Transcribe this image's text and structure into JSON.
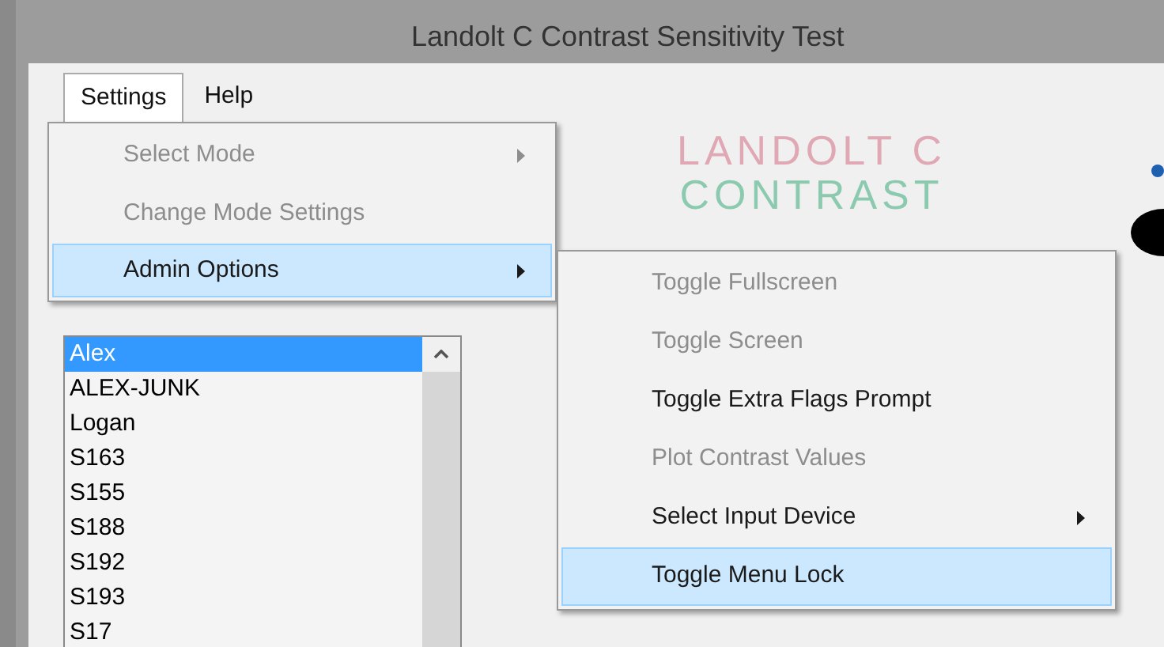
{
  "window": {
    "title": "Landolt C Contrast Sensitivity Test"
  },
  "menu_bar": [
    {
      "label": "Settings",
      "selected": true
    },
    {
      "label": "Help",
      "selected": false
    }
  ],
  "banner": {
    "lines": [
      {
        "text": "LANDOLT C",
        "color": "#e0a8b4"
      },
      {
        "text": "CONTRAST",
        "color": "#8ccab0"
      }
    ]
  },
  "user_list": {
    "items": [
      {
        "label": "Alex",
        "selected": true
      },
      {
        "label": "ALEX-JUNK",
        "selected": false
      },
      {
        "label": "Logan",
        "selected": false
      },
      {
        "label": "S163",
        "selected": false
      },
      {
        "label": "S155",
        "selected": false
      },
      {
        "label": "S188",
        "selected": false
      },
      {
        "label": "S192",
        "selected": false
      },
      {
        "label": "S193",
        "selected": false
      },
      {
        "label": "S17",
        "selected": false
      }
    ]
  },
  "settings_menu": {
    "items": [
      {
        "label": "Select Mode",
        "disabled": true,
        "has_submenu": true,
        "selected": false
      },
      {
        "label": "Change Mode Settings",
        "disabled": true,
        "has_submenu": false,
        "selected": false
      },
      {
        "label": "Admin Options",
        "disabled": false,
        "has_submenu": true,
        "selected": true
      }
    ]
  },
  "admin_submenu": {
    "items": [
      {
        "label": "Toggle Fullscreen",
        "disabled": true,
        "has_submenu": false,
        "selected": false
      },
      {
        "label": "Toggle Screen",
        "disabled": true,
        "has_submenu": false,
        "selected": false
      },
      {
        "label": "Toggle Extra Flags Prompt",
        "disabled": false,
        "has_submenu": false,
        "selected": false
      },
      {
        "label": "Plot Contrast Values",
        "disabled": true,
        "has_submenu": false,
        "selected": false
      },
      {
        "label": "Select Input Device",
        "disabled": false,
        "has_submenu": true,
        "selected": false
      },
      {
        "label": "Toggle Menu Lock",
        "disabled": false,
        "has_submenu": false,
        "selected": true
      }
    ]
  }
}
